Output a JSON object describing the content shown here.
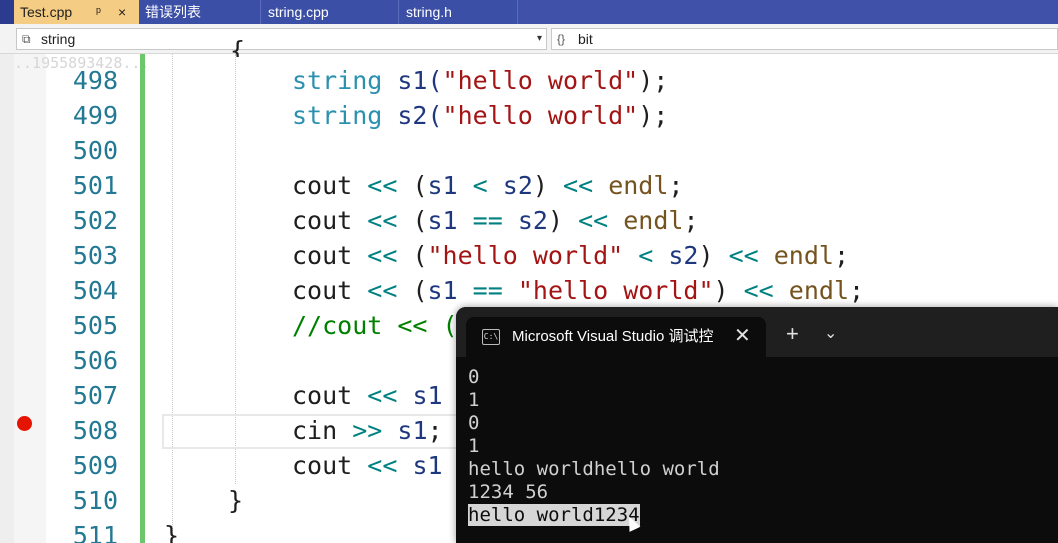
{
  "tabs": [
    {
      "label": "Test.cpp",
      "pin": "ᵖ",
      "close": "×",
      "active": true
    },
    {
      "label": "错误列表"
    },
    {
      "label": "string.cpp"
    },
    {
      "label": "string.h"
    }
  ],
  "nav": {
    "scope": "string",
    "member": "bit",
    "dropdown": "▾",
    "member_icon": "{}"
  },
  "watermark": "..1955893428...",
  "line_numbers": [
    "498",
    "499",
    "500",
    "501",
    "502",
    "503",
    "504",
    "505",
    "506",
    "507",
    "508",
    "509",
    "510",
    "511"
  ],
  "code": {
    "l497": "{",
    "l498_type": "string",
    "l498_name": " s1(",
    "l498_str": "\"hello world\"",
    "l498_end": ");",
    "l499_type": "string",
    "l499_name": " s2(",
    "l499_str": "\"hello world\"",
    "l499_end": ");",
    "cout": "cout",
    "cin": "cin",
    "shl": "<<",
    "shr": ">>",
    "lt": "<",
    "eq": "==",
    "endl": "endl",
    "s1": "s1",
    "s2": "s2",
    "hello": "\"hello world\"",
    "comment505": "//cout << (",
    "l510": "}",
    "l511": "}"
  },
  "console": {
    "title": "Microsoft Visual Studio 调试控",
    "close": "✕",
    "plus": "+",
    "chevron": "⌄",
    "icon": "C:\\",
    "lines": [
      "0",
      "1",
      "0",
      "1",
      "hello worldhello world",
      "1234 56"
    ],
    "selected_line": "hello world1234"
  },
  "breakpoint_color": "#e51400",
  "accent_color": "#3f51a8"
}
